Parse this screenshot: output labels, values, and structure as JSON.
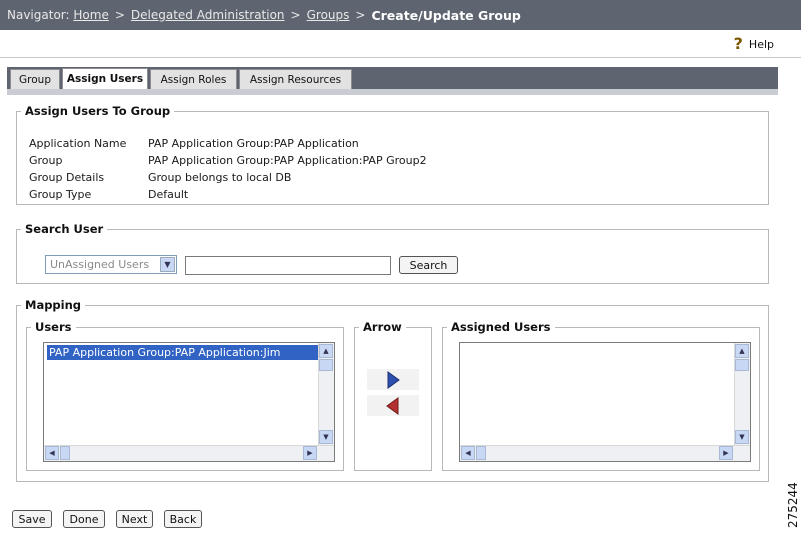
{
  "navigator": {
    "prefix": "Navigator:",
    "crumbs": [
      "Home",
      "Delegated Administration",
      "Groups"
    ],
    "separator": ">",
    "current": "Create/Update Group"
  },
  "help": {
    "label": "Help",
    "icon": "help-question-icon"
  },
  "tabs": [
    {
      "label": "Group",
      "active": false
    },
    {
      "label": "Assign Users",
      "active": true
    },
    {
      "label": "Assign Roles",
      "active": false
    },
    {
      "label": "Assign Resources",
      "active": false
    }
  ],
  "assign_section": {
    "legend": "Assign Users To Group",
    "fields": [
      {
        "label": "Application Name",
        "value": "PAP Application Group:PAP Application"
      },
      {
        "label": "Group",
        "value": "PAP Application Group:PAP Application:PAP Group2"
      },
      {
        "label": "Group Details",
        "value": "Group belongs to local DB"
      },
      {
        "label": "Group Type",
        "value": "Default"
      }
    ]
  },
  "search_section": {
    "legend": "Search User",
    "filter_selected": "UnAssigned Users",
    "query": "",
    "search_label": "Search"
  },
  "mapping": {
    "legend": "Mapping",
    "users_legend": "Users",
    "users": [
      "PAP Application Group:PAP Application:Jim"
    ],
    "arrow_legend": "Arrow",
    "assigned_legend": "Assigned Users",
    "assigned": [],
    "colors": {
      "right_arrow": "#2d4fb0",
      "left_arrow": "#b53030",
      "selection": "#3163c5"
    }
  },
  "buttons": {
    "save": "Save",
    "done": "Done",
    "next": "Next",
    "back": "Back"
  },
  "figure_number": "275244"
}
